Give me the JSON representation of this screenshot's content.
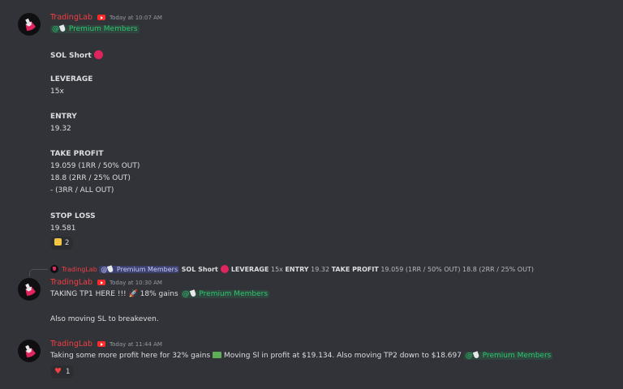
{
  "messages": [
    {
      "author": "TradingLab",
      "time": "Today at 10:07 AM",
      "mention": "Premium Members",
      "body": {
        "title": "SOL Short",
        "leverage_label": "LEVERAGE",
        "leverage_value": "15x",
        "entry_label": "ENTRY",
        "entry_value": "19.32",
        "tp_label": "TAKE PROFIT",
        "tp1": "19.059 (1RR / 50% OUT)",
        "tp2": "18.8 (2RR / 25% OUT)",
        "tp3": "- (3RR / ALL OUT)",
        "sl_label": "STOP LOSS",
        "sl_value": "19.581"
      },
      "reaction": {
        "emoji": "thumbs-up",
        "count": "2"
      }
    },
    {
      "reply": {
        "author": "TradingLab",
        "mention": "Premium Members",
        "bold1": "SOL Short",
        "bold2": "LEVERAGE",
        "text2": "15x",
        "bold3": "ENTRY",
        "text3": "19.32",
        "bold4": "TAKE PROFIT",
        "text4": "19.059 (1RR / 50% OUT) 18.8 (2RR / 25% OUT)"
      },
      "author": "TradingLab",
      "time": "Today at 10:30 AM",
      "line1_a": "TAKING TP1 HERE !!!",
      "line1_b": "18% gains",
      "mention": "Premium Members",
      "line2": "Also moving SL to breakeven."
    },
    {
      "author": "TradingLab",
      "time": "Today at 11:44 AM",
      "text_a": "Taking some more profit here for 32% gains",
      "text_b": "Moving Sl in profit at $19.134. Also moving TP2 down to $18.697",
      "mention": "Premium Members",
      "reaction": {
        "emoji": "heart",
        "count": "1"
      }
    }
  ],
  "colors": {
    "background": "#313338",
    "username": "#f23f42",
    "mention": "#2dc770"
  }
}
